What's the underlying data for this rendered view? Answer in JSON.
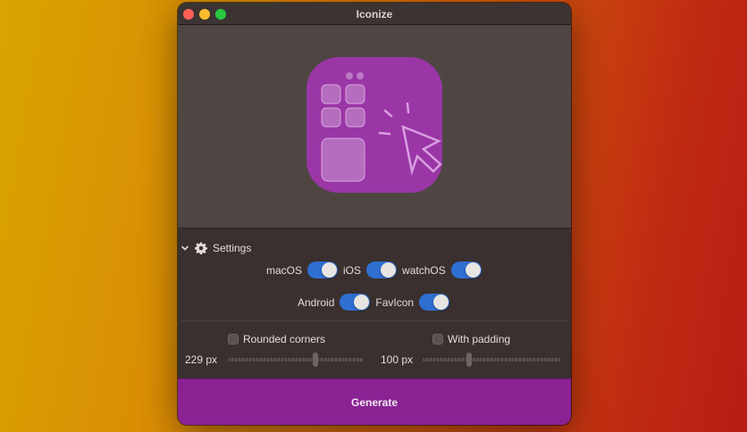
{
  "window": {
    "title": "Iconize"
  },
  "settings": {
    "header_label": "Settings",
    "platforms_row1": [
      {
        "label": "macOS",
        "enabled": true
      },
      {
        "label": "iOS",
        "enabled": true
      },
      {
        "label": "watchOS",
        "enabled": true
      }
    ],
    "platforms_row2": [
      {
        "label": "Android",
        "enabled": true
      },
      {
        "label": "FavIcon",
        "enabled": true
      }
    ],
    "rounded_corners": {
      "label": "Rounded corners",
      "checked": false,
      "value_text": "229 px",
      "slider_fraction": 0.65
    },
    "with_padding": {
      "label": "With padding",
      "checked": false,
      "value_text": "100 px",
      "slider_fraction": 0.33
    }
  },
  "generate_label": "Generate",
  "colors": {
    "accent_purple": "#8a2294",
    "toggle_blue": "#2f6fd1",
    "icon_purple": "#9a36a6"
  },
  "icons": {
    "app_preview": "iconize-app-icon",
    "settings": "gear-icon",
    "disclosure": "chevron-down-icon"
  }
}
